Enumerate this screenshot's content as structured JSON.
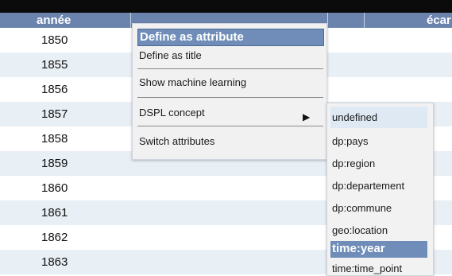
{
  "table": {
    "headers": {
      "year": "année",
      "ecart": "écar"
    },
    "years": [
      "1850",
      "1855",
      "1856",
      "1857",
      "1858",
      "1859",
      "1860",
      "1861",
      "1862",
      "1863"
    ]
  },
  "context_menu": {
    "header": "Define as attribute",
    "items": [
      {
        "label": "Define as title"
      },
      {
        "label": "Show machine learning"
      },
      {
        "label": "DSPL concept"
      },
      {
        "label": "Switch attributes"
      }
    ],
    "arrow_icon": "chevron-right-icon"
  },
  "submenu": {
    "items": [
      {
        "label": "undefined"
      },
      {
        "label": "dp:pays"
      },
      {
        "label": "dp:region"
      },
      {
        "label": "dp:departement"
      },
      {
        "label": "dp:commune"
      },
      {
        "label": "geo:location"
      },
      {
        "label": "time:year"
      },
      {
        "label": "time:time_point"
      }
    ]
  },
  "colors": {
    "header_bg": "#6b84ad",
    "highlight_bg": "#6f8db8",
    "row_alt_bg": "#e8eff5"
  }
}
